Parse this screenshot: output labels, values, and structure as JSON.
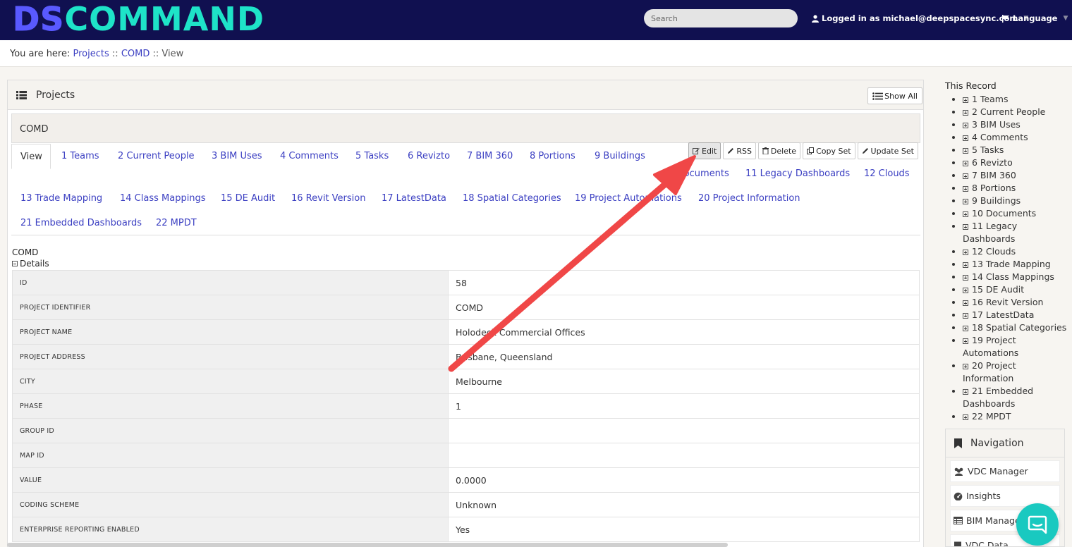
{
  "brand": {
    "part1": "DS",
    "part2": "COMMAND"
  },
  "header": {
    "search_placeholder": "Search",
    "user_label": "Logged in as michael@deepspacesync.com",
    "language_label": "Language"
  },
  "breadcrumb": {
    "prefix": "You are here:",
    "items": [
      "Projects",
      "COMD"
    ],
    "separator": "::",
    "current": "View"
  },
  "panel": {
    "title": "Projects",
    "show_all": "Show All",
    "record_title": "COMD"
  },
  "tabs": {
    "view": "View",
    "items": [
      "1 Teams",
      "2 Current People",
      "3 BIM Uses",
      "4 Comments",
      "5 Tasks",
      "6 Revizto",
      "7 BIM 360",
      "8 Portions",
      "9 Buildings",
      "10 Documents",
      "11 Legacy Dashboards",
      "12 Clouds",
      "13 Trade Mapping",
      "14 Class Mappings",
      "15 DE Audit",
      "16 Revit Version",
      "17 LatestData",
      "18 Spatial Categories",
      "19 Project Automations",
      "20 Project Information",
      "21 Embedded Dashboards",
      "22 MPDT"
    ]
  },
  "actions": {
    "edit": "Edit",
    "rss": "RSS",
    "delete": "Delete",
    "copy_set": "Copy Set",
    "update_set": "Update Set"
  },
  "record": {
    "name": "COMD",
    "details_label": "Details",
    "fields": [
      {
        "label": "ID",
        "value": "58"
      },
      {
        "label": "PROJECT IDENTIFIER",
        "value": "COMD"
      },
      {
        "label": "PROJECT NAME",
        "value": "Holodeck Commercial Offices"
      },
      {
        "label": "PROJECT ADDRESS",
        "value": "Brisbane, Queensland"
      },
      {
        "label": "CITY",
        "value": "Melbourne"
      },
      {
        "label": "PHASE",
        "value": "1"
      },
      {
        "label": "GROUP ID",
        "value": ""
      },
      {
        "label": "MAP ID",
        "value": ""
      },
      {
        "label": "VALUE",
        "value": "0.0000"
      },
      {
        "label": "CODING SCHEME",
        "value": "Unknown"
      },
      {
        "label": "ENTERPRISE REPORTING ENABLED",
        "value": "Yes"
      }
    ]
  },
  "sidebar": {
    "title": "This Record",
    "items": [
      "1 Teams",
      "2 Current People",
      "3 BIM Uses",
      "4 Comments",
      "5 Tasks",
      "6 Revizto",
      "7 BIM 360",
      "8 Portions",
      "9 Buildings",
      "10 Documents",
      "11 Legacy Dashboards",
      "12 Clouds",
      "13 Trade Mapping",
      "14 Class Mappings",
      "15 DE Audit",
      "16 Revit Version",
      "17 LatestData",
      "18 Spatial Categories",
      "19 Project Automations",
      "20 Project Information",
      "21 Embedded Dashboards",
      "22 MPDT"
    ]
  },
  "navigation": {
    "title": "Navigation",
    "items": [
      {
        "label": "VDC Manager",
        "icon": "users-icon"
      },
      {
        "label": "Insights",
        "icon": "dashboard-icon"
      },
      {
        "label": "BIM Manager",
        "icon": "table-icon"
      },
      {
        "label": "VDC Data",
        "icon": "book-icon"
      }
    ]
  },
  "colors": {
    "header_bg": "#101050",
    "brand_ds": "#5959ff",
    "brand_command": "#1ee3c8",
    "link": "#3b3fc2",
    "arrow": "#f04747",
    "chat": "#19c9c0"
  }
}
